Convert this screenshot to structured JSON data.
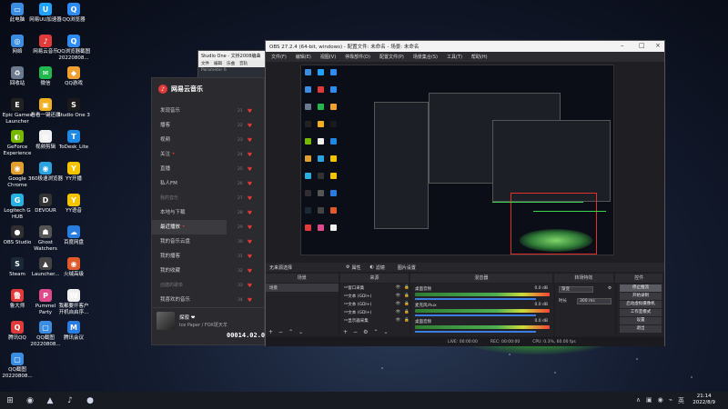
{
  "desktop": {
    "icons": [
      {
        "label": "此电脑",
        "color": "#3a8de0",
        "glyph": "▭"
      },
      {
        "label": "网易UU加速器",
        "color": "#1fa3ff",
        "glyph": "U"
      },
      {
        "label": "QQ浏览器",
        "color": "#2e8cf0",
        "glyph": "Q"
      },
      {
        "label": "网络",
        "color": "#3a8de0",
        "glyph": "◎"
      },
      {
        "label": "网易云音乐",
        "color": "#e03a3a",
        "glyph": "♪"
      },
      {
        "label": "QQ浏览器截图20220808...",
        "color": "#2e8cf0",
        "glyph": "Q"
      },
      {
        "label": "回收站",
        "color": "#6b7a8f",
        "glyph": "♻"
      },
      {
        "label": "微信",
        "color": "#21b94e",
        "glyph": "✉"
      },
      {
        "label": "QQ游戏",
        "color": "#f0a030",
        "glyph": "◆"
      },
      {
        "label": "Epic Games Launcher",
        "color": "#222",
        "glyph": "E"
      },
      {
        "label": "看看一键还原",
        "color": "#f0b020",
        "glyph": "▣"
      },
      {
        "label": "Studio One 3",
        "color": "#1a1a1a",
        "glyph": "S"
      },
      {
        "label": "GeForce Experience",
        "color": "#76b900",
        "glyph": "◐"
      },
      {
        "label": "视频剪辑",
        "color": "#f0f0f0",
        "glyph": "▤"
      },
      {
        "label": "ToDesk_Lite",
        "color": "#1e88e5",
        "glyph": "T"
      },
      {
        "label": "Google Chrome",
        "color": "#e0a030",
        "glyph": "◉"
      },
      {
        "label": "360极速浏览器",
        "color": "#2aa3e0",
        "glyph": "◉"
      },
      {
        "label": "YY开播",
        "color": "#f5c400",
        "glyph": "Y"
      },
      {
        "label": "Logitech G HUB",
        "color": "#2ab0e0",
        "glyph": "G"
      },
      {
        "label": "DEVOUR",
        "color": "#333",
        "glyph": "D"
      },
      {
        "label": "YY语音",
        "color": "#f5c400",
        "glyph": "Y"
      },
      {
        "label": "OBS Studio",
        "color": "#302e31",
        "glyph": "●"
      },
      {
        "label": "Ghost Watchers",
        "color": "#555",
        "glyph": "☗"
      },
      {
        "label": "百度网盘",
        "color": "#2a7de0",
        "glyph": "☁"
      },
      {
        "label": "Steam",
        "color": "#1b2838",
        "glyph": "S"
      },
      {
        "label": "Launcher...",
        "color": "#444",
        "glyph": "▲"
      },
      {
        "label": "火绒高级",
        "color": "#e05a2a",
        "glyph": "◉"
      },
      {
        "label": "鲁大师",
        "color": "#e03a3a",
        "glyph": "鲁"
      },
      {
        "label": "Pummel Party",
        "color": "#e04a8a",
        "glyph": "P"
      },
      {
        "label": "我都要开客户开机自启序...",
        "color": "#f0f0f0",
        "glyph": "W"
      },
      {
        "label": "腾讯QQ",
        "color": "#e03a3a",
        "glyph": "Q"
      },
      {
        "label": "QQ截图20220808...",
        "color": "#3a8de0",
        "glyph": "▢"
      },
      {
        "label": "腾讯会议",
        "color": "#2a7de0",
        "glyph": "M"
      },
      {
        "label": "QQ截图20220808...",
        "color": "#3a8de0",
        "glyph": "▢"
      }
    ]
  },
  "studio_one": {
    "title": "Studio One - 文桥2008编曲",
    "menu": [
      "文件",
      "编辑",
      "乐曲",
      "音轨"
    ],
    "status": "Parameter 6"
  },
  "music": {
    "app_name": "网易云音乐",
    "nav": [
      {
        "label": "发现音乐",
        "section": false,
        "dot": false,
        "active": false
      },
      {
        "label": "播客",
        "section": false,
        "dot": false,
        "active": false
      },
      {
        "label": "视频",
        "section": false,
        "dot": false,
        "active": false
      },
      {
        "label": "关注",
        "section": false,
        "dot": true,
        "active": false
      },
      {
        "label": "直播",
        "section": false,
        "dot": false,
        "active": false
      },
      {
        "label": "私人FM",
        "section": false,
        "dot": false,
        "active": false
      },
      {
        "label": "我的音乐",
        "section": true,
        "dot": false,
        "active": false
      },
      {
        "label": "本地与下载",
        "section": false,
        "dot": false,
        "active": false
      },
      {
        "label": "最近播放",
        "section": false,
        "dot": true,
        "active": true
      },
      {
        "label": "我的音乐云盘",
        "section": false,
        "dot": false,
        "active": false
      },
      {
        "label": "我的播客",
        "section": false,
        "dot": false,
        "active": false
      },
      {
        "label": "我的收藏",
        "section": false,
        "dot": false,
        "active": false
      },
      {
        "label": "创建的歌单",
        "section": true,
        "dot": false,
        "active": false
      },
      {
        "label": "我喜欢的音乐",
        "section": false,
        "dot": false,
        "active": false
      }
    ],
    "list_numbers": [
      "21",
      "22",
      "23",
      "24",
      "25",
      "26",
      "27",
      "28",
      "29",
      "30",
      "31",
      "32",
      "33",
      "34"
    ],
    "song": "探寂 ❤",
    "artist": "Ice Paper / FOX斑天羊",
    "timer": "00014.02.04"
  },
  "obs": {
    "title": "OBS 27.2.4 (64-bit, windows) - 配置文件: 未命名 - 场景: 未命名",
    "menu": [
      "文件(F)",
      "编辑(E)",
      "视图(V)",
      "停靠部件(D)",
      "配置文件(P)",
      "场景集合(S)",
      "工具(T)",
      "帮助(H)"
    ],
    "scene_bar": {
      "left": "无来源选择",
      "props": "属性",
      "filters": "滤镜",
      "output": "图片设置"
    },
    "dock_titles": {
      "scenes": "场景",
      "sources": "来源",
      "mixer": "混音器",
      "transitions": "转场特效",
      "controls": "控件"
    },
    "scenes": [
      "场景"
    ],
    "sources": [
      "窗口采集",
      "文本 (GDI+)",
      "文本 (GDI+)",
      "文本 (GDI+)",
      "显示器采集"
    ],
    "mixer": [
      {
        "label": "桌面音频",
        "db": "0.0 dB"
      },
      {
        "label": "麦克风/Aux",
        "db": "0.0 dB"
      },
      {
        "label": "桌面音频",
        "db": "0.0 dB"
      }
    ],
    "transitions": {
      "type": "渐变",
      "duration_label": "时长",
      "duration": "300 ms"
    },
    "controls": [
      "停止推流",
      "开始录制",
      "启动虚拟摄像机",
      "工作室模式",
      "设置",
      "退出"
    ],
    "status": {
      "live": "LIVE: 00:00:00",
      "rec": "REC: 00:00:00",
      "cpu": "CPU: 0.3%, 60.00 fps"
    },
    "accent_red": "#e0302a",
    "accent_green": "#3bd64a"
  },
  "taskbar": {
    "items": [
      "⊞",
      "◉",
      "▲",
      "♪",
      "●"
    ],
    "tray": [
      "∧",
      "▣",
      "◉",
      "⌁",
      "英"
    ],
    "time": "21:14",
    "date": "2022/8/9"
  }
}
